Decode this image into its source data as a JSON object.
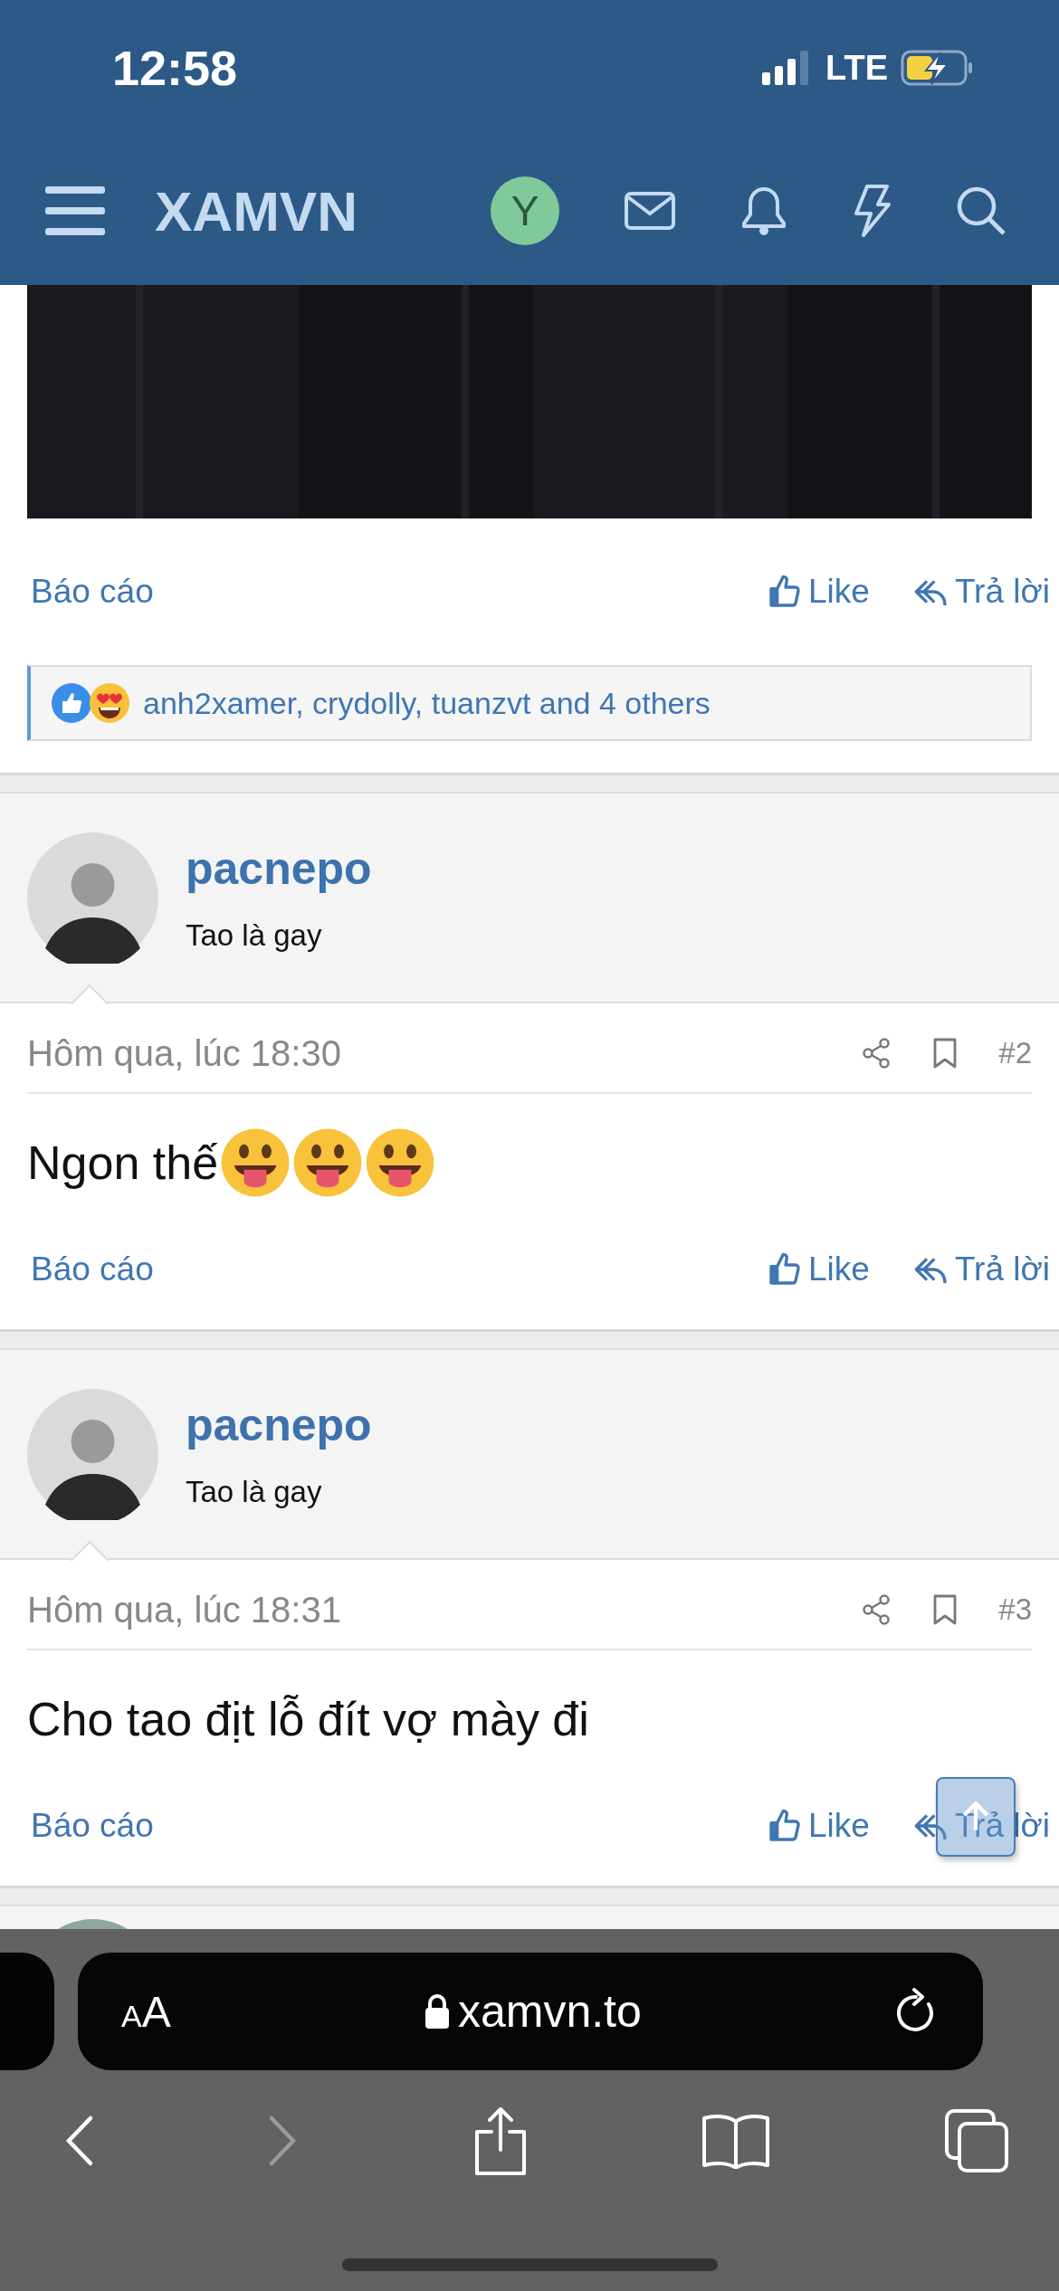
{
  "status_bar": {
    "time": "12:58",
    "network": "LTE"
  },
  "navbar": {
    "logo": "XAMVN",
    "avatar_letter": "Y"
  },
  "first_post": {
    "actions": {
      "report": "Báo cáo",
      "like": "Like",
      "reply": "Trả lời"
    },
    "reactions": "anh2xamer, crydolly, tuanzvt and 4 others"
  },
  "posts": [
    {
      "username": "pacnepo",
      "user_title": "Tao là gay",
      "date": "Hôm qua, lúc 18:30",
      "number": "#2",
      "message": [
        {
          "kind": "text",
          "text": "Ngon thế"
        },
        {
          "kind": "emoji"
        },
        {
          "kind": "emoji"
        },
        {
          "kind": "emoji"
        }
      ],
      "actions": {
        "report": "Báo cáo",
        "like": "Like",
        "reply": "Trả lời"
      }
    },
    {
      "username": "pacnepo",
      "user_title": "Tao là gay",
      "date": "Hôm qua, lúc 18:31",
      "number": "#3",
      "message": [
        {
          "kind": "text",
          "text": "Cho tao địt lỗ đít vợ mày đi"
        }
      ],
      "actions": {
        "report": "Báo cáo",
        "like": "Like",
        "reply": "Trả lời"
      }
    }
  ],
  "browser": {
    "text_size_label": "AA",
    "url": "xamvn.to",
    "back_disabled": false,
    "forward_disabled": true
  }
}
